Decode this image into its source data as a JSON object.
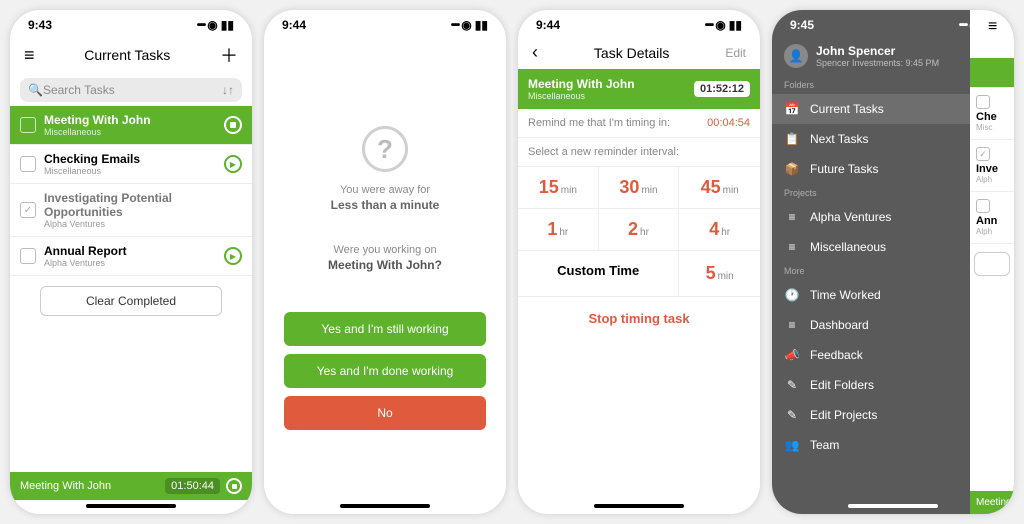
{
  "screen1": {
    "time": "9:43",
    "title": "Current Tasks",
    "search_placeholder": "Search Tasks",
    "tasks": [
      {
        "name": "Meeting With John",
        "category": "Miscellaneous",
        "active": true,
        "completed": false
      },
      {
        "name": "Checking Emails",
        "category": "Miscellaneous",
        "active": false,
        "completed": false
      },
      {
        "name": "Investigating Potential Opportunities",
        "category": "Alpha Ventures",
        "active": false,
        "completed": true
      },
      {
        "name": "Annual Report",
        "category": "Alpha Ventures",
        "active": false,
        "completed": false
      }
    ],
    "clear_label": "Clear Completed",
    "timing_task": "Meeting With John",
    "elapsed": "01:50:44"
  },
  "screen2": {
    "time": "9:44",
    "away_label": "You were away for",
    "away_duration": "Less than a minute",
    "question_label": "Were you working on",
    "task_name": "Meeting With John?",
    "btn1": "Yes and I'm still working",
    "btn2": "Yes and I'm done working",
    "btn3": "No"
  },
  "screen3": {
    "time": "9:44",
    "title": "Task Details",
    "edit": "Edit",
    "task_name": "Meeting With John",
    "task_category": "Miscellaneous",
    "elapsed": "01:52:12",
    "remind_label": "Remind me that I'm timing in:",
    "remind_value": "00:04:54",
    "select_label": "Select a new reminder interval:",
    "intervals": [
      {
        "num": "15",
        "unit": "min"
      },
      {
        "num": "30",
        "unit": "min"
      },
      {
        "num": "45",
        "unit": "min"
      },
      {
        "num": "1",
        "unit": "hr"
      },
      {
        "num": "2",
        "unit": "hr"
      },
      {
        "num": "4",
        "unit": "hr"
      }
    ],
    "custom_label": "Custom Time",
    "five": {
      "num": "5",
      "unit": "min"
    },
    "stop_label": "Stop timing task"
  },
  "screen4": {
    "time": "9:45",
    "user_name": "John Spencer",
    "user_sub": "Spencer Investments: 9:45 PM",
    "section_folders": "Folders",
    "folders": [
      {
        "icon": "📅",
        "label": "Current Tasks",
        "selected": true
      },
      {
        "icon": "📋",
        "label": "Next Tasks",
        "selected": false
      },
      {
        "icon": "📦",
        "label": "Future Tasks",
        "selected": false
      }
    ],
    "section_projects": "Projects",
    "projects": [
      {
        "icon": "≡",
        "label": "Alpha Ventures"
      },
      {
        "icon": "≡",
        "label": "Miscellaneous"
      }
    ],
    "section_more": "More",
    "more": [
      {
        "icon": "🕐",
        "label": "Time Worked"
      },
      {
        "icon": "≡",
        "label": "Dashboard"
      },
      {
        "icon": "📣",
        "label": "Feedback"
      },
      {
        "icon": "✎",
        "label": "Edit Folders"
      },
      {
        "icon": "✎",
        "label": "Edit Projects"
      },
      {
        "icon": "👥",
        "label": "Team"
      }
    ],
    "peek": {
      "tasks": [
        "Che",
        "Inve",
        "Ann"
      ],
      "cats": [
        "Misc",
        "Alph",
        "Alph"
      ],
      "bottom": "Meeting"
    }
  }
}
